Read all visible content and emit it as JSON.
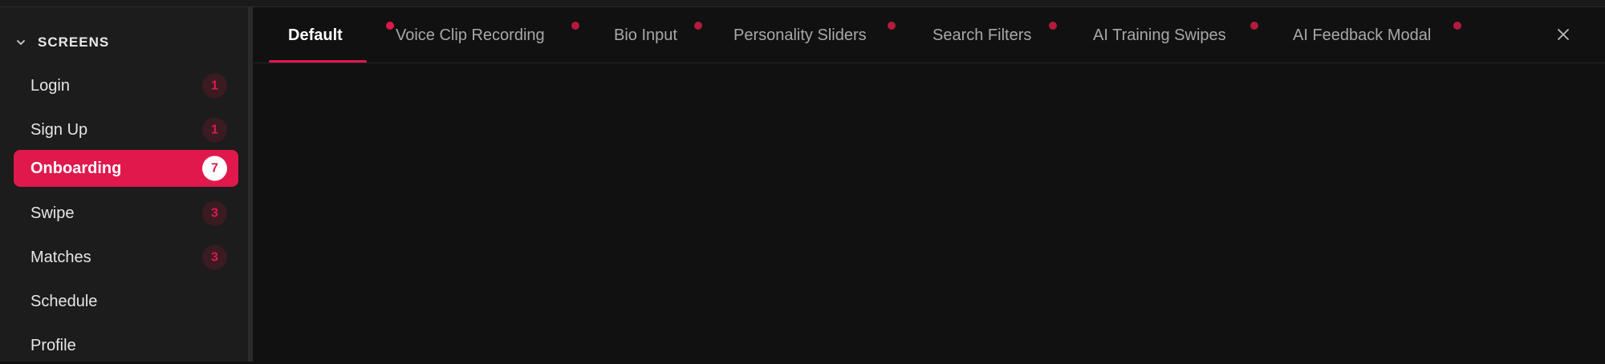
{
  "sidebar": {
    "section_title": "SCREENS",
    "items": [
      {
        "label": "Login",
        "badge": "1"
      },
      {
        "label": "Sign Up",
        "badge": "1"
      },
      {
        "label": "Onboarding",
        "badge": "7"
      },
      {
        "label": "Swipe",
        "badge": "3"
      },
      {
        "label": "Matches",
        "badge": "3"
      },
      {
        "label": "Schedule"
      },
      {
        "label": "Profile"
      }
    ],
    "active_item": "Onboarding"
  },
  "tabs": [
    {
      "label": "Default"
    },
    {
      "label": "Voice Clip Recording"
    },
    {
      "label": "Bio Input"
    },
    {
      "label": "Personality Sliders"
    },
    {
      "label": "Search Filters"
    },
    {
      "label": "AI Training Swipes"
    },
    {
      "label": "AI Feedback Modal"
    }
  ],
  "active_tab": "Default",
  "icons": {
    "section_toggle": "chevron-down-icon",
    "close": "close-icon"
  },
  "colors": {
    "accent": "#e0184c",
    "background": "#111111",
    "sidebar_background": "#1c1c1c"
  }
}
